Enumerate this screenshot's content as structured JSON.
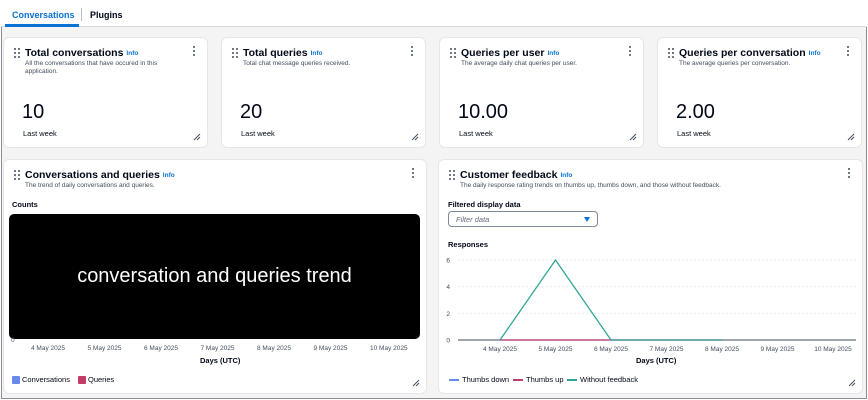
{
  "tabs": [
    {
      "label": "Conversations",
      "active": true
    },
    {
      "label": "Plugins",
      "active": false
    }
  ],
  "info_label": "Info",
  "metrics": [
    {
      "title": "Total conversations",
      "description": "All the conversations that have occured in this application.",
      "value": "10",
      "period": "Last week"
    },
    {
      "title": "Total queries",
      "description": "Total chat message queries received.",
      "value": "20",
      "period": "Last week"
    },
    {
      "title": "Queries per user",
      "description": "The average daily chat queries per user.",
      "value": "10.00",
      "period": "Last week"
    },
    {
      "title": "Queries per conversation",
      "description": "The average queries per conversation.",
      "value": "2.00",
      "period": "Last week"
    }
  ],
  "conversations_panel": {
    "title": "Conversations and queries",
    "description": "The trend of daily conversations and queries.",
    "counts_label": "Counts",
    "placeholder_text": "conversation and queries trend",
    "y_zero": "0",
    "x_ticks": [
      "4 May 2025",
      "5 May 2025",
      "6 May 2025",
      "7 May 2025",
      "8 May 2025",
      "9 May 2025",
      "10 May 2025"
    ],
    "x_axis_title": "Days (UTC)",
    "legend": [
      {
        "label": "Conversations",
        "color": "#688ae8"
      },
      {
        "label": "Queries",
        "color": "#c33d69"
      }
    ]
  },
  "feedback_panel": {
    "title": "Customer feedback",
    "description": "The daily response rating trends on thumbs up, thumbs down, and those without feedback.",
    "filter_label": "Filtered display data",
    "filter_placeholder": "Filter data",
    "responses_label": "Responses",
    "x_axis_title": "Days (UTC)",
    "legend": [
      {
        "label": "Thumbs down",
        "color": "#688ae8"
      },
      {
        "label": "Thumbs up",
        "color": "#c33d69"
      },
      {
        "label": "Without feedback",
        "color": "#2ea597"
      }
    ]
  },
  "chart_data": {
    "type": "line",
    "title": "",
    "xlabel": "Days (UTC)",
    "ylabel": "Responses",
    "x": [
      "4 May 2025",
      "5 May 2025",
      "6 May 2025",
      "7 May 2025",
      "8 May 2025",
      "9 May 2025",
      "10 May 2025"
    ],
    "yticks": [
      0,
      2,
      4,
      6
    ],
    "ylim": [
      0,
      6
    ],
    "grid": true,
    "legend_position": "bottom",
    "series": [
      {
        "name": "Thumbs down",
        "color": "#688ae8",
        "values": [
          0,
          0,
          0,
          0,
          0
        ]
      },
      {
        "name": "Thumbs up",
        "color": "#c33d69",
        "values": [
          0,
          0,
          0,
          0,
          0
        ]
      },
      {
        "name": "Without feedback",
        "color": "#2ea597",
        "values": [
          0,
          6,
          0,
          0,
          0
        ]
      }
    ]
  }
}
